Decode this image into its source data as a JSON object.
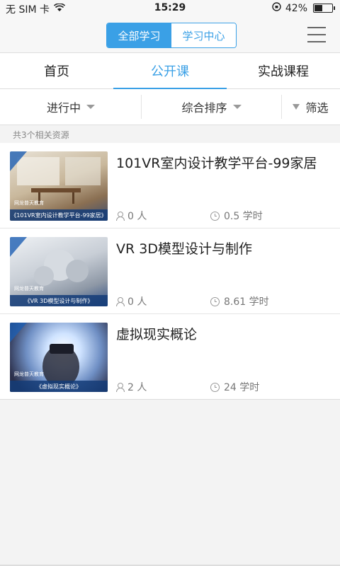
{
  "status_bar": {
    "carrier": "无 SIM 卡",
    "time": "15:29",
    "battery": "42%"
  },
  "header": {
    "segments": [
      "全部学习",
      "学习中心"
    ],
    "active_segment": 0
  },
  "tabs": [
    "首页",
    "公开课",
    "实战课程"
  ],
  "active_tab": 1,
  "filters": {
    "status": "进行中",
    "sort": "综合排序",
    "filter": "筛选"
  },
  "result_count": "共3个相关资源",
  "courses": [
    {
      "title": "101VR室内设计教学平台-99家居",
      "students": "0 人",
      "hours": "0.5 学时",
      "thumb_brand": "网龙普天教育",
      "thumb_caption": "《101VR室内设计教学平台-99家居》"
    },
    {
      "title": "VR 3D模型设计与制作",
      "students": "0 人",
      "hours": "8.61 学时",
      "thumb_brand": "网龙普天教育",
      "thumb_caption": "《VR 3D模型设计与制作》"
    },
    {
      "title": "虚拟现实概论",
      "students": "2 人",
      "hours": "24 学时",
      "thumb_brand": "网龙普天教育",
      "thumb_caption": "《虚拟现实概论》"
    }
  ],
  "colors": {
    "accent": "#3aa0e6"
  }
}
